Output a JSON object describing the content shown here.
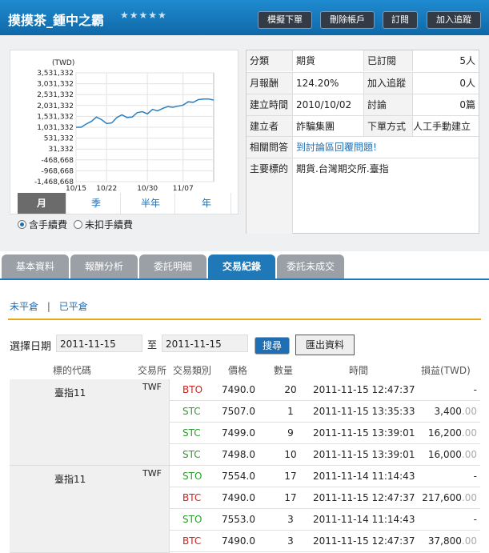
{
  "header": {
    "title": "摸摸茶_鍾中之霸",
    "stars": "★★★★★",
    "buttons": [
      "模擬下單",
      "刪除帳戶",
      "訂閱",
      "加入追蹤"
    ]
  },
  "chart_data": {
    "type": "line",
    "ylabel": "(TWD)",
    "y_ticks": [
      "3,531,332",
      "3,031,332",
      "2,531,332",
      "2,031,332",
      "1,531,332",
      "1,031,332",
      "531,332",
      "31,332",
      "-468,668",
      "-968,668",
      "-1,468,668"
    ],
    "x_ticks": [
      "10/15",
      "10/22",
      "10/30",
      "11/07"
    ],
    "ylim": [
      -1468668,
      3531332
    ],
    "x": [
      "10/15",
      "10/16",
      "10/18",
      "10/19",
      "10/20",
      "10/21",
      "10/22",
      "10/23",
      "10/24",
      "10/25",
      "10/26",
      "10/27",
      "10/28",
      "10/29",
      "10/30",
      "10/31",
      "11/01",
      "11/02",
      "11/03",
      "11/04",
      "11/05",
      "11/07",
      "11/08",
      "11/09",
      "11/10",
      "11/11",
      "11/14",
      "11/15"
    ],
    "values": [
      1031332,
      1031332,
      1180000,
      1300000,
      1500000,
      1380000,
      1200000,
      1230000,
      1480000,
      1600000,
      1480000,
      1500000,
      1700000,
      1750000,
      1650000,
      1850000,
      1780000,
      1900000,
      1980000,
      1950000,
      2000000,
      2050000,
      2200000,
      2180000,
      2300000,
      2330000,
      2330000,
      2280000
    ]
  },
  "period_tabs": [
    "月",
    "季",
    "半年",
    "年"
  ],
  "fee_options": [
    {
      "label": "含手續費",
      "selected": true
    },
    {
      "label": "未扣手續費",
      "selected": false
    }
  ],
  "info": {
    "category_label": "分類",
    "category": "期貨",
    "subscribed_label": "已訂閱",
    "subscribed": "5人",
    "monthly_return_label": "月報酬",
    "monthly_return": "124.20%",
    "tracking_label": "加入追蹤",
    "tracking": "0人",
    "created_label": "建立時間",
    "created": "2010/10/02",
    "discussion_label": "討論",
    "discussion": "0篇",
    "creator_label": "建立者",
    "creator": "詐騙集團",
    "order_method_label": "下單方式",
    "order_method": "人工手動建立",
    "qa_label": "相關問答",
    "qa_link": "到討論區回覆問題!",
    "target_label": "主要標的",
    "target": "期貨.台灣期交所.臺指"
  },
  "tabs": [
    "基本資料",
    "報酬分析",
    "委託明細",
    "交易紀錄",
    "委託未成交"
  ],
  "active_tab": "交易紀錄",
  "subtabs": {
    "open": "未平倉",
    "closed": "已平倉",
    "separator": "|"
  },
  "date_filter": {
    "label": "選擇日期",
    "from": "2011-11-15",
    "to_label": "至",
    "to": "2011-11-15",
    "search": "搜尋",
    "export": "匯出資料"
  },
  "table": {
    "headers": [
      "標的代碼",
      "交易所",
      "交易類別",
      "價格",
      "數量",
      "時間",
      "損益(TWD)"
    ],
    "groups": [
      {
        "symbol": "臺指11",
        "exchange": "TWF",
        "rows": [
          {
            "type": "BTO",
            "type_color": "#d0201c",
            "price": "7490.0",
            "qty": "20",
            "time": "2011-11-15 12:47:37",
            "pnl": "-",
            "pnl_dec": ""
          },
          {
            "type": "STC",
            "type_color": "#2c9c2c",
            "price": "7507.0",
            "qty": "1",
            "time": "2011-11-15 13:35:33",
            "pnl": "3,400",
            "pnl_dec": ".00"
          },
          {
            "type": "STC",
            "type_color": "#2c9c2c",
            "price": "7499.0",
            "qty": "9",
            "time": "2011-11-15 13:39:01",
            "pnl": "16,200",
            "pnl_dec": ".00"
          },
          {
            "type": "STC",
            "type_color": "#2c9c2c",
            "price": "7498.0",
            "qty": "10",
            "time": "2011-11-15 13:39:01",
            "pnl": "16,000",
            "pnl_dec": ".00"
          }
        ]
      },
      {
        "symbol": "臺指11",
        "exchange": "TWF",
        "rows": [
          {
            "type": "STO",
            "type_color": "#2c9c2c",
            "price": "7554.0",
            "qty": "17",
            "time": "2011-11-14 11:14:43",
            "pnl": "-",
            "pnl_dec": ""
          },
          {
            "type": "BTC",
            "type_color": "#d0201c",
            "price": "7490.0",
            "qty": "17",
            "time": "2011-11-15 12:47:37",
            "pnl": "217,600",
            "pnl_dec": ".00"
          },
          {
            "type": "STO",
            "type_color": "#2c9c2c",
            "price": "7553.0",
            "qty": "3",
            "time": "2011-11-14 11:14:43",
            "pnl": "-",
            "pnl_dec": ""
          },
          {
            "type": "BTC",
            "type_color": "#d0201c",
            "price": "7490.0",
            "qty": "3",
            "time": "2011-11-15 12:47:37",
            "pnl": "37,800",
            "pnl_dec": ".00"
          }
        ]
      }
    ]
  }
}
